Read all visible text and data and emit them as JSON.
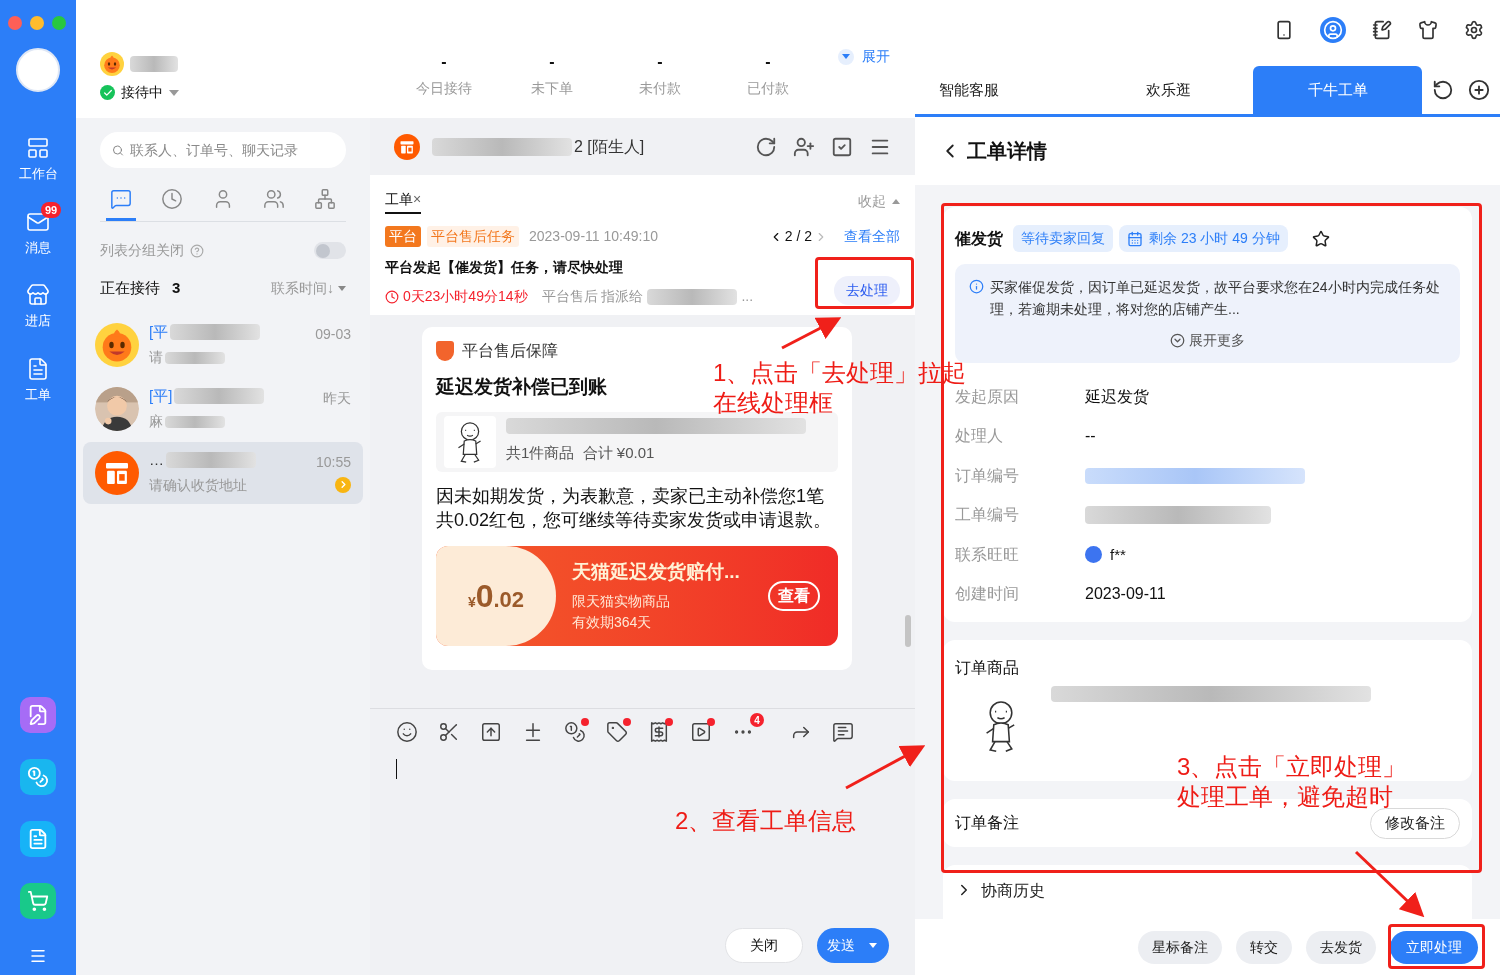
{
  "sidebar": {
    "items": [
      {
        "label": "工作台",
        "kind": "desk"
      },
      {
        "label": "消息",
        "kind": "mail",
        "badge": "99"
      },
      {
        "label": "进店",
        "kind": "store"
      },
      {
        "label": "工单",
        "kind": "order"
      }
    ]
  },
  "user": {
    "status": "接待中"
  },
  "stats": [
    {
      "value": "-",
      "label": "今日接待"
    },
    {
      "value": "-",
      "label": "未下单"
    },
    {
      "value": "-",
      "label": "未付款"
    },
    {
      "value": "-",
      "label": "已付款"
    }
  ],
  "expand": "展开",
  "search": {
    "placeholder": "联系人、订单号、聊天记录"
  },
  "contact_tabs": [
    {
      "kind": "chat",
      "selected": true
    },
    {
      "kind": "clock",
      "selected": false
    },
    {
      "kind": "person",
      "selected": false
    },
    {
      "kind": "group",
      "selected": false
    },
    {
      "kind": "org",
      "selected": false
    }
  ],
  "group_toggle": {
    "label": "列表分组关闭",
    "on": false
  },
  "list_header": {
    "title": "正在接待",
    "count": "3",
    "sort": "联系时间↓"
  },
  "contacts": [
    {
      "name": "[平",
      "preview": "请",
      "time": "09-03",
      "kind": "mascot",
      "selected": false
    },
    {
      "name": "[平]",
      "preview": "麻",
      "time": "昨天",
      "selected": false
    },
    {
      "name": "…",
      "preview": "请确认收货地址",
      "time": "10:55",
      "kind": "taobao",
      "selected": true
    }
  ],
  "chat": {
    "title": "2 [陌生人]"
  },
  "workorder": {
    "tab": "工单",
    "close": "×",
    "collapse": "收起",
    "tags": [
      "平台",
      "平台售后任务"
    ],
    "time": "2023-09-11 10:49:10",
    "pager": "2 / 2",
    "view_all": "查看全部",
    "title": "平台发起【催发货】任务，请尽快处理",
    "countdown": "0天23小时49分14秒",
    "assign": "平台售后 指派给",
    "assign_tail": "...",
    "action": "去处理"
  },
  "message": {
    "source": "平台售后保障",
    "title": "延迟发货补偿已到账",
    "goods_summary": "共1件商品  合计 ¥0.01",
    "body": "因未如期发货，为表歉意，卖家已主动补偿您1笔共0.02红包，您可继续等待卖家发货或申请退款。",
    "coupon": {
      "currency": "¥",
      "amount": "0",
      "decimals": ".02",
      "title": "天猫延迟发货赔付...",
      "line1": "限天猫实物商品",
      "line2": "有效期364天",
      "button": "查看"
    }
  },
  "toolbar": [
    {
      "kind": "emoji",
      "dot": false
    },
    {
      "kind": "scissors",
      "dot": false
    },
    {
      "kind": "upload",
      "dot": false
    },
    {
      "kind": "calc",
      "dot": false
    },
    {
      "kind": "coin",
      "dot": true
    },
    {
      "kind": "tag",
      "dot": true
    },
    {
      "kind": "receipt",
      "dot": true
    },
    {
      "kind": "video",
      "dot": true
    },
    {
      "kind": "more",
      "dot": false,
      "badge": "4"
    },
    {
      "kind": "forward",
      "dot": false
    },
    {
      "kind": "quick",
      "dot": false
    }
  ],
  "composer": {
    "close": "关闭",
    "send": "发送"
  },
  "tabs": [
    {
      "label": "智能客服",
      "selected": false
    },
    {
      "label": "欢乐逛",
      "selected": false
    },
    {
      "label": "千牛工单",
      "selected": true
    }
  ],
  "detail": {
    "title": "工单详情",
    "type": "催发货",
    "status": "等待卖家回复",
    "remaining": "剩余 23 小时 49 分钟",
    "notice": "买家催促发货，因订单已延迟发货，故平台要求您在24小时内完成任务处理，若逾期未处理，将对您的店铺产生...",
    "expand_more": "展开更多",
    "fields": [
      {
        "label": "发起原因",
        "kind": "text",
        "value": "延迟发货"
      },
      {
        "label": "处理人",
        "kind": "text",
        "value": "--"
      },
      {
        "label": "订单编号",
        "kind": "link_redacted"
      },
      {
        "label": "工单编号",
        "kind": "redacted"
      },
      {
        "label": "联系旺旺",
        "kind": "wangwang",
        "value": "f**"
      },
      {
        "label": "创建时间",
        "kind": "text",
        "value": "2023-09-11"
      }
    ],
    "goods_title": "订单商品",
    "remark": "订单备注",
    "edit_remark": "修改备注",
    "history": "协商历史"
  },
  "actions": [
    {
      "label": "星标备注",
      "primary": false
    },
    {
      "label": "转交",
      "primary": false
    },
    {
      "label": "去发货",
      "primary": false
    },
    {
      "label": "立即处理",
      "primary": true
    }
  ],
  "annotations": [
    {
      "lines": [
        "1、点击「去处理」拉起",
        "在线处理框"
      ]
    },
    {
      "lines": [
        "2、查看工单信息"
      ]
    },
    {
      "lines": [
        "3、点击「立即处理」",
        "处理工单，避免超时"
      ]
    }
  ]
}
